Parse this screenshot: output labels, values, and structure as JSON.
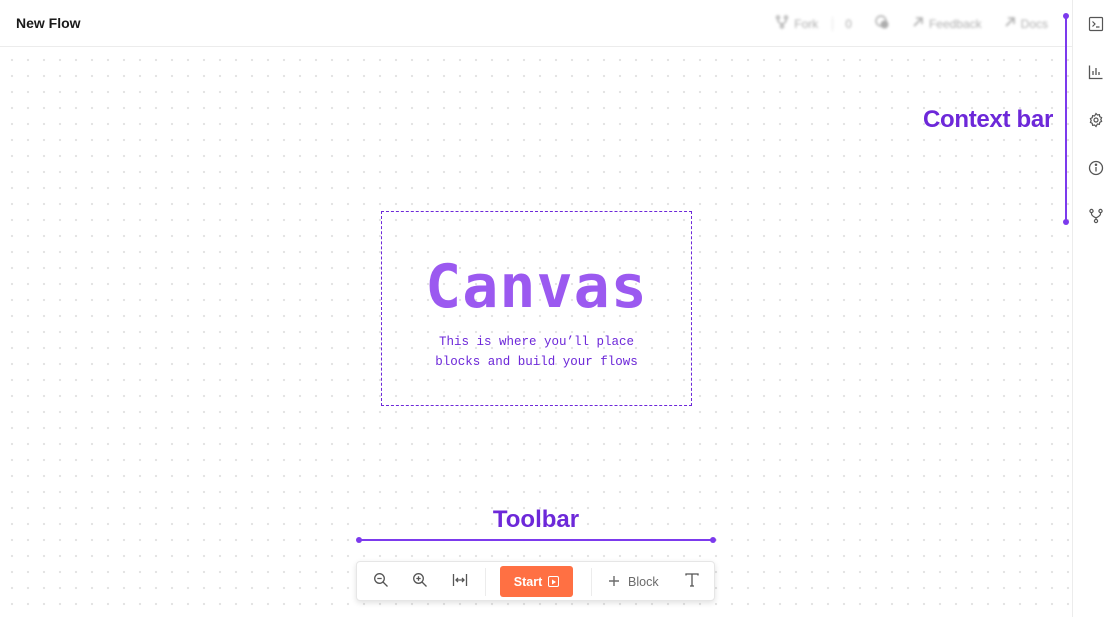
{
  "header": {
    "title": "New Flow",
    "actions": {
      "fork_label": "Fork",
      "fork_count": "0",
      "feedback_label": "Feedback",
      "docs_label": "Docs"
    }
  },
  "context_bar": {
    "icons": [
      "terminal-icon",
      "bar-chart-icon",
      "settings-icon",
      "info-icon",
      "branch-icon"
    ]
  },
  "annotations": {
    "context_bar_label": "Context bar",
    "canvas_title": "Canvas",
    "canvas_subtitle_line1": "This is where you’ll place",
    "canvas_subtitle_line2": "blocks and build your flows",
    "toolbar_label": "Toolbar"
  },
  "toolbar": {
    "start_label": "Start",
    "block_label": "Block",
    "icons": [
      "zoom-out-icon",
      "zoom-in-icon",
      "fit-width-icon",
      "play-icon",
      "plus-icon",
      "text-icon"
    ]
  },
  "colors": {
    "accent_purple": "#6d28d9",
    "canvas_title_purple": "#9b59f0",
    "start_orange": "#ff7043"
  }
}
